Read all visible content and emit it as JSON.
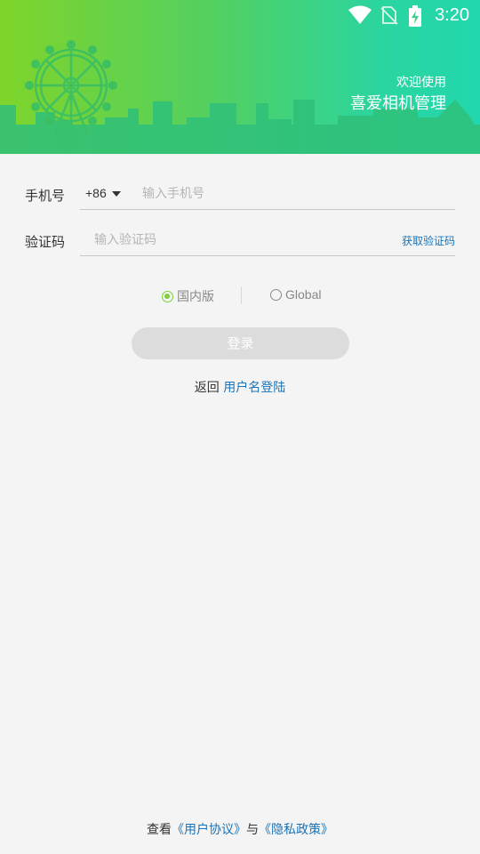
{
  "status_bar": {
    "time": "3:20",
    "icons": [
      "wifi-icon",
      "no-sim-icon",
      "battery-charging-icon"
    ]
  },
  "header": {
    "welcome": "欢迎使用",
    "app_name": "喜爱相机管理",
    "decoration": "ferris-wheel-skyline-illustration"
  },
  "form": {
    "phone_label": "手机号",
    "country_code": "+86",
    "phone_placeholder": "输入手机号",
    "phone_value": "",
    "code_label": "验证码",
    "code_placeholder": "输入验证码",
    "code_value": "",
    "get_code": "获取验证码"
  },
  "region": {
    "options": [
      {
        "label": "国内版",
        "selected": true
      },
      {
        "label": "Global",
        "selected": false
      }
    ]
  },
  "login_button": "登录",
  "back": {
    "text": "返回",
    "link": "用户名登陆"
  },
  "footer": {
    "prefix": "查看",
    "user_agreement": "《用户协议》",
    "conjunction": "与",
    "privacy_policy": "《隐私政策》"
  },
  "colors": {
    "accent_green": "#7ecf3a",
    "link_blue": "#1a73b8",
    "header_gradient_start": "#7fd42a",
    "header_gradient_end": "#22d7ae",
    "button_disabled": "#dcdcdc"
  }
}
